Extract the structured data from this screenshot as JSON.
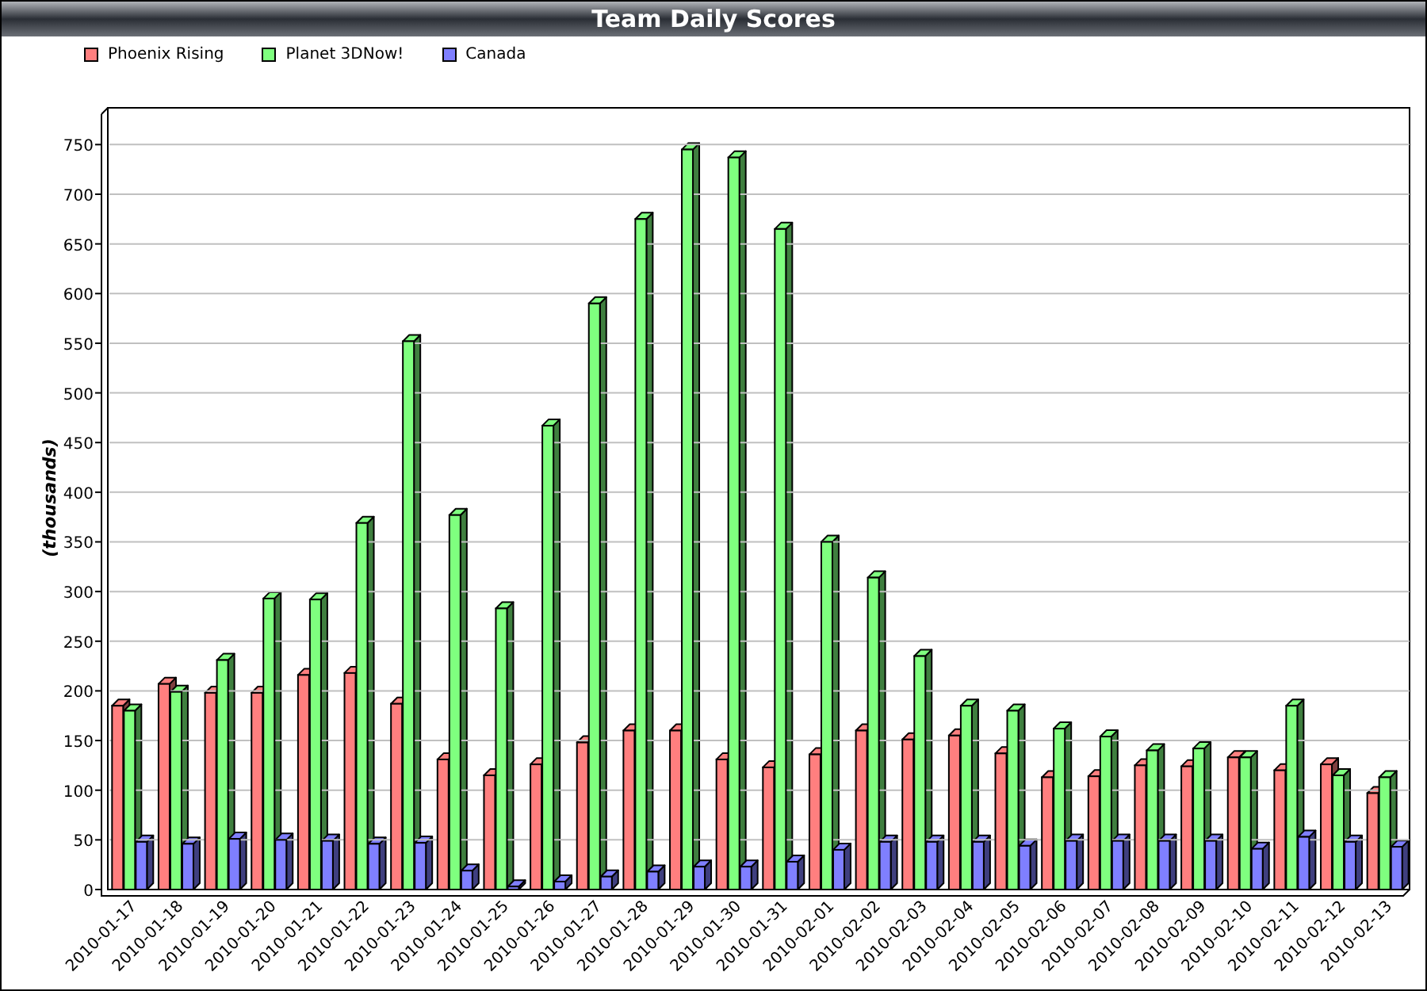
{
  "chart_data": {
    "type": "bar",
    "title": "Team Daily Scores",
    "ylabel": "(thousands)",
    "categories": [
      "2010-01-17",
      "2010-01-18",
      "2010-01-19",
      "2010-01-20",
      "2010-01-21",
      "2010-01-22",
      "2010-01-23",
      "2010-01-24",
      "2010-01-25",
      "2010-01-26",
      "2010-01-27",
      "2010-01-28",
      "2010-01-29",
      "2010-01-30",
      "2010-01-31",
      "2010-02-01",
      "2010-02-02",
      "2010-02-03",
      "2010-02-04",
      "2010-02-05",
      "2010-02-06",
      "2010-02-07",
      "2010-02-08",
      "2010-02-09",
      "2010-02-10",
      "2010-02-11",
      "2010-02-12",
      "2010-02-13"
    ],
    "series": [
      {
        "name": "Phoenix Rising",
        "color": "#ff7f7f",
        "values": [
          185,
          207,
          198,
          198,
          216,
          218,
          187,
          131,
          115,
          126,
          148,
          160,
          160,
          131,
          123,
          136,
          160,
          151,
          155,
          137,
          113,
          114,
          125,
          124,
          133,
          120,
          126,
          97
        ]
      },
      {
        "name": "Planet 3DNow!",
        "color": "#7fff7f",
        "values": [
          180,
          199,
          231,
          293,
          292,
          369,
          552,
          377,
          283,
          467,
          590,
          675,
          745,
          737,
          665,
          350,
          314,
          235,
          185,
          180,
          162,
          154,
          140,
          142,
          133,
          185,
          115,
          113
        ]
      },
      {
        "name": "Canada",
        "color": "#7f7fff",
        "values": [
          48,
          46,
          51,
          50,
          49,
          46,
          47,
          19,
          3,
          8,
          13,
          18,
          23,
          23,
          28,
          40,
          48,
          48,
          48,
          44,
          49,
          49,
          49,
          49,
          41,
          53,
          48,
          43
        ]
      }
    ],
    "ylim": [
      0,
      787
    ],
    "grid": true,
    "yticks": [
      0,
      50,
      100,
      150,
      200,
      250,
      300,
      350,
      400,
      450,
      500,
      550,
      600,
      650,
      700,
      750
    ]
  }
}
